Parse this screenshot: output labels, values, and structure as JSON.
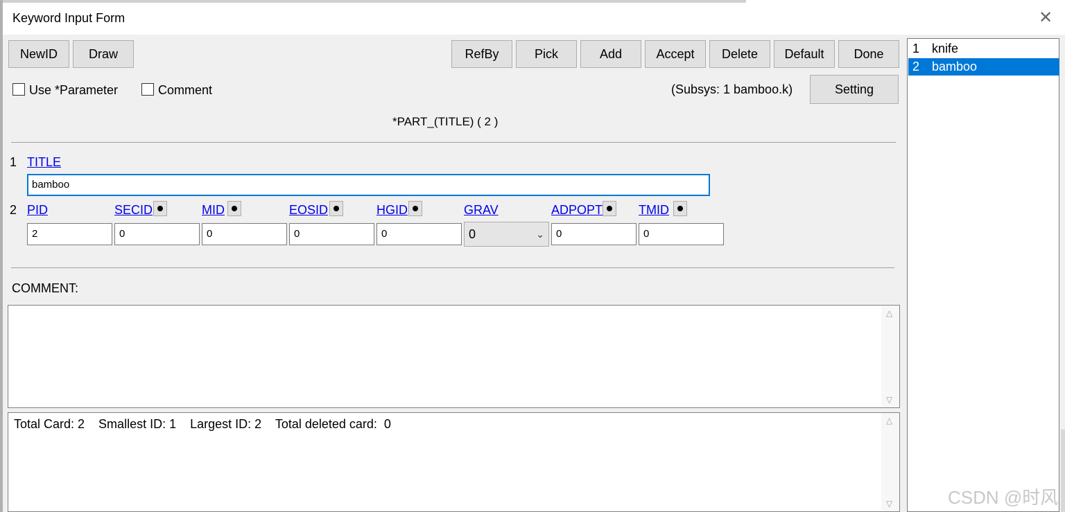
{
  "window": {
    "title": "Keyword Input Form",
    "close_glyph": "✕"
  },
  "toolbar": {
    "left_buttons": [
      "NewID",
      "Draw"
    ],
    "right_buttons": [
      "RefBy",
      "Pick",
      "Add",
      "Accept",
      "Delete",
      "Default",
      "Done"
    ]
  },
  "options": {
    "use_parameter": {
      "label": "Use *Parameter",
      "checked": false
    },
    "comment": {
      "label": "Comment",
      "checked": false
    },
    "subsys": "(Subsys: 1 bamboo.k)",
    "setting_button": "Setting"
  },
  "keyword_heading": "*PART_(TITLE)    ( 2 )",
  "card1": {
    "row_number": "1",
    "field": "TITLE",
    "value": "bamboo"
  },
  "card2": {
    "row_number": "2",
    "fields": [
      {
        "name": "PID",
        "value": "2",
        "has_pick": false
      },
      {
        "name": "SECID",
        "value": "0",
        "has_pick": true
      },
      {
        "name": "MID",
        "value": "0",
        "has_pick": true
      },
      {
        "name": "EOSID",
        "value": "0",
        "has_pick": true
      },
      {
        "name": "HGID",
        "value": "0",
        "has_pick": true
      },
      {
        "name": "GRAV",
        "value": "0",
        "has_pick": false,
        "dropdown": true
      },
      {
        "name": "ADPOPT",
        "value": "0",
        "has_pick": true
      },
      {
        "name": "TMID",
        "value": "0",
        "has_pick": true
      }
    ]
  },
  "comment_label": "COMMENT:",
  "status_text": "Total Card: 2    Smallest ID: 1    Largest ID: 2    Total deleted card:  0",
  "list": [
    {
      "num": "1",
      "name": "knife",
      "selected": false
    },
    {
      "num": "2",
      "name": "bamboo",
      "selected": true
    }
  ],
  "watermark": "CSDN @时风",
  "colors": {
    "selection": "#0078d7",
    "link": "#0000ee",
    "panel": "#f0f0f0"
  }
}
